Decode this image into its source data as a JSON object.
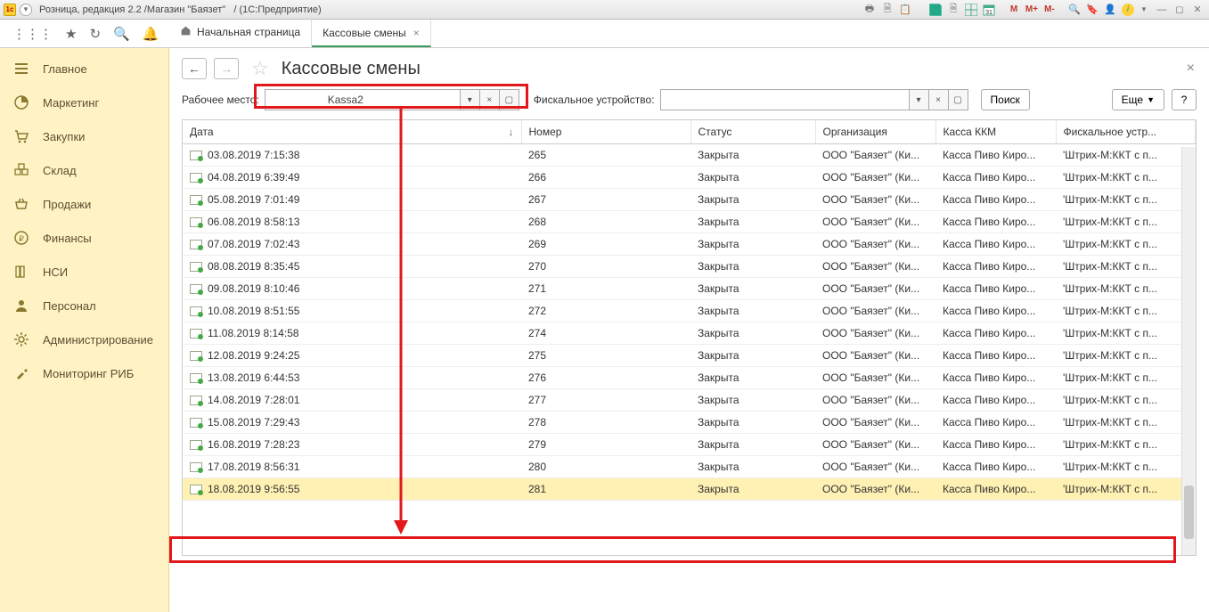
{
  "titlebar": {
    "app_title_a": "Розница, редакция 2.2 /Магазин \"Баязет\"",
    "app_title_b": "/ (1С:Предприятие)",
    "m1": "M",
    "m2": "M+",
    "m3": "M-"
  },
  "tabs": {
    "home": "Начальная страница",
    "active": "Кассовые смены"
  },
  "sidebar": {
    "items": [
      {
        "label": "Главное"
      },
      {
        "label": "Маркетинг"
      },
      {
        "label": "Закупки"
      },
      {
        "label": "Склад"
      },
      {
        "label": "Продажи"
      },
      {
        "label": "Финансы"
      },
      {
        "label": "НСИ"
      },
      {
        "label": "Персонал"
      },
      {
        "label": "Администрирование"
      },
      {
        "label": "Мониторинг РИБ"
      }
    ]
  },
  "page": {
    "title": "Кассовые смены",
    "workplace_label": "Рабочее место:",
    "workplace_value": "Kassa2",
    "fiscal_label": "Фискальное устройство:",
    "fiscal_value": "",
    "search_btn": "Поиск",
    "more_btn": "Еще"
  },
  "grid": {
    "columns": [
      "Дата",
      "Номер",
      "Статус",
      "Организация",
      "Касса ККМ",
      "Фискальное устр..."
    ],
    "rows": [
      {
        "date": "03.08.2019 7:15:38",
        "num": "265",
        "status": "Закрыта",
        "org": "ООО \"Баязет\" (Ки...",
        "kkm": "Касса Пиво Киро...",
        "fisc": "'Штрих-М:ККТ с п..."
      },
      {
        "date": "04.08.2019 6:39:49",
        "num": "266",
        "status": "Закрыта",
        "org": "ООО \"Баязет\" (Ки...",
        "kkm": "Касса Пиво Киро...",
        "fisc": "'Штрих-М:ККТ с п..."
      },
      {
        "date": "05.08.2019 7:01:49",
        "num": "267",
        "status": "Закрыта",
        "org": "ООО \"Баязет\" (Ки...",
        "kkm": "Касса Пиво Киро...",
        "fisc": "'Штрих-М:ККТ с п..."
      },
      {
        "date": "06.08.2019 8:58:13",
        "num": "268",
        "status": "Закрыта",
        "org": "ООО \"Баязет\" (Ки...",
        "kkm": "Касса Пиво Киро...",
        "fisc": "'Штрих-М:ККТ с п..."
      },
      {
        "date": "07.08.2019 7:02:43",
        "num": "269",
        "status": "Закрыта",
        "org": "ООО \"Баязет\" (Ки...",
        "kkm": "Касса Пиво Киро...",
        "fisc": "'Штрих-М:ККТ с п..."
      },
      {
        "date": "08.08.2019 8:35:45",
        "num": "270",
        "status": "Закрыта",
        "org": "ООО \"Баязет\" (Ки...",
        "kkm": "Касса Пиво Киро...",
        "fisc": "'Штрих-М:ККТ с п..."
      },
      {
        "date": "09.08.2019 8:10:46",
        "num": "271",
        "status": "Закрыта",
        "org": "ООО \"Баязет\" (Ки...",
        "kkm": "Касса Пиво Киро...",
        "fisc": "'Штрих-М:ККТ с п..."
      },
      {
        "date": "10.08.2019 8:51:55",
        "num": "272",
        "status": "Закрыта",
        "org": "ООО \"Баязет\" (Ки...",
        "kkm": "Касса Пиво Киро...",
        "fisc": "'Штрих-М:ККТ с п..."
      },
      {
        "date": "11.08.2019 8:14:58",
        "num": "274",
        "status": "Закрыта",
        "org": "ООО \"Баязет\" (Ки...",
        "kkm": "Касса Пиво Киро...",
        "fisc": "'Штрих-М:ККТ с п..."
      },
      {
        "date": "12.08.2019 9:24:25",
        "num": "275",
        "status": "Закрыта",
        "org": "ООО \"Баязет\" (Ки...",
        "kkm": "Касса Пиво Киро...",
        "fisc": "'Штрих-М:ККТ с п..."
      },
      {
        "date": "13.08.2019 6:44:53",
        "num": "276",
        "status": "Закрыта",
        "org": "ООО \"Баязет\" (Ки...",
        "kkm": "Касса Пиво Киро...",
        "fisc": "'Штрих-М:ККТ с п..."
      },
      {
        "date": "14.08.2019 7:28:01",
        "num": "277",
        "status": "Закрыта",
        "org": "ООО \"Баязет\" (Ки...",
        "kkm": "Касса Пиво Киро...",
        "fisc": "'Штрих-М:ККТ с п..."
      },
      {
        "date": "15.08.2019 7:29:43",
        "num": "278",
        "status": "Закрыта",
        "org": "ООО \"Баязет\" (Ки...",
        "kkm": "Касса Пиво Киро...",
        "fisc": "'Штрих-М:ККТ с п..."
      },
      {
        "date": "16.08.2019 7:28:23",
        "num": "279",
        "status": "Закрыта",
        "org": "ООО \"Баязет\" (Ки...",
        "kkm": "Касса Пиво Киро...",
        "fisc": "'Штрих-М:ККТ с п..."
      },
      {
        "date": "17.08.2019 8:56:31",
        "num": "280",
        "status": "Закрыта",
        "org": "ООО \"Баязет\" (Ки...",
        "kkm": "Касса Пиво Киро...",
        "fisc": "'Штрих-М:ККТ с п..."
      },
      {
        "date": "18.08.2019 9:56:55",
        "num": "281",
        "status": "Закрыта",
        "org": "ООО \"Баязет\" (Ки...",
        "kkm": "Касса Пиво Киро...",
        "fisc": "'Штрих-М:ККТ с п...",
        "selected": true
      }
    ]
  }
}
